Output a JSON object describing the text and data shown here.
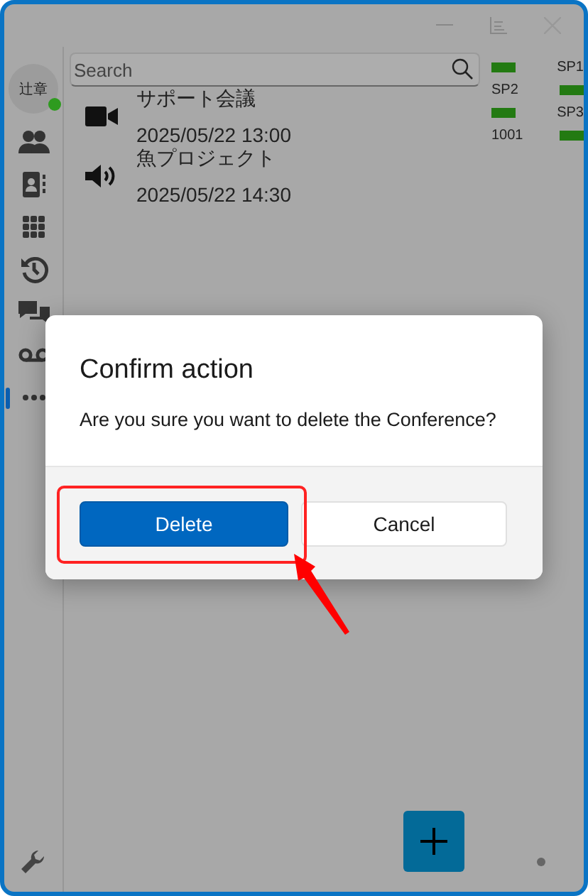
{
  "sidebar": {
    "avatar": {
      "initials": "辻章",
      "color": "#2e9b1f"
    },
    "items": [
      {
        "kind": "contacts",
        "selected": false
      },
      {
        "kind": "contact-card",
        "selected": false
      },
      {
        "kind": "dialpad",
        "selected": false
      },
      {
        "kind": "history",
        "selected": false
      },
      {
        "kind": "chat",
        "selected": false
      },
      {
        "kind": "voicemail",
        "selected": false
      },
      {
        "kind": "more",
        "selected": true
      }
    ]
  },
  "search": {
    "placeholder": "Search"
  },
  "conferences": [
    {
      "kind": "video",
      "title": "サポート会議",
      "time": "2025/05/22 13:00"
    },
    {
      "kind": "audio",
      "title": "魚プロジェクト",
      "time": "2025/05/22 14:30"
    }
  ],
  "lines": [
    {
      "label": "SP1",
      "kind": "bar_left"
    },
    {
      "label": "SP2",
      "kind": "bar_right"
    },
    {
      "label": "SP3",
      "kind": "bar_left"
    },
    {
      "label": "1001",
      "kind": "bar_right"
    }
  ],
  "dialog": {
    "title": "Confirm action",
    "message": "Are you sure you want to delete the Conference?",
    "buttons": [
      {
        "label": "Delete",
        "kind": "primary"
      },
      {
        "label": "Cancel",
        "kind": "secondary"
      }
    ]
  }
}
